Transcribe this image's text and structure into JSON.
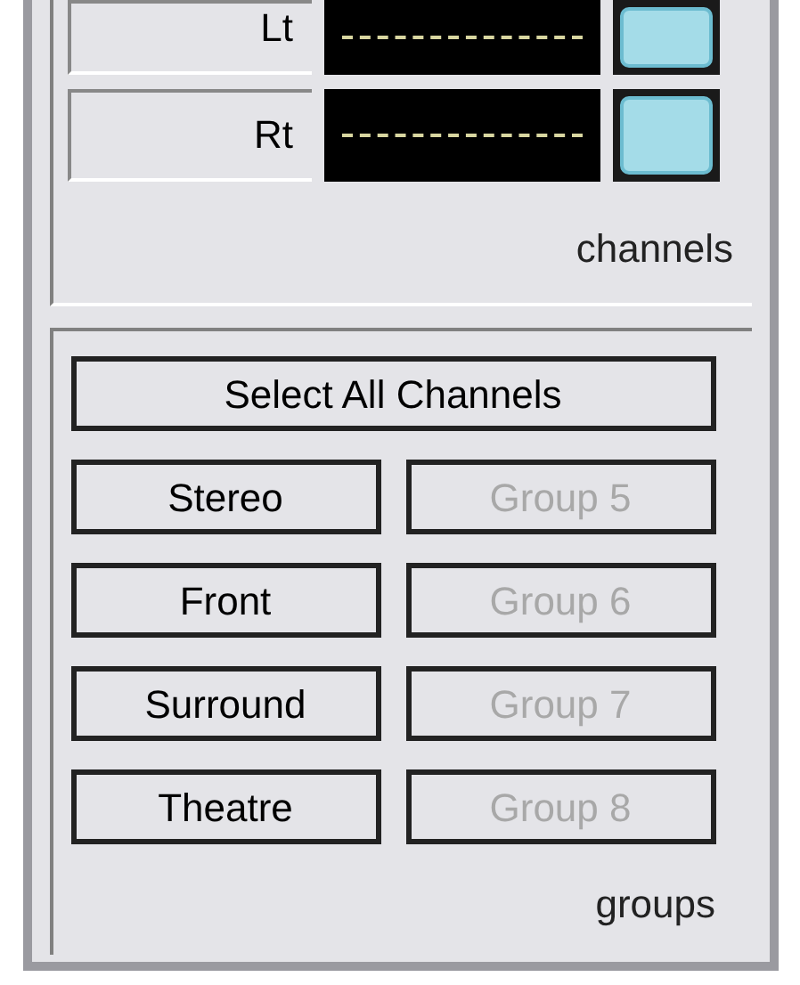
{
  "channels": {
    "rows": [
      {
        "label": "Lt"
      },
      {
        "label": "Rt"
      }
    ],
    "caption": "channels"
  },
  "groups": {
    "select_all": "Select All Channels",
    "buttons": [
      {
        "label": "Stereo",
        "disabled": false
      },
      {
        "label": "Group 5",
        "disabled": true
      },
      {
        "label": "Front",
        "disabled": false
      },
      {
        "label": "Group 6",
        "disabled": true
      },
      {
        "label": "Surround",
        "disabled": false
      },
      {
        "label": "Group 7",
        "disabled": true
      },
      {
        "label": "Theatre",
        "disabled": false
      },
      {
        "label": "Group 8",
        "disabled": true
      }
    ],
    "caption": "groups"
  }
}
